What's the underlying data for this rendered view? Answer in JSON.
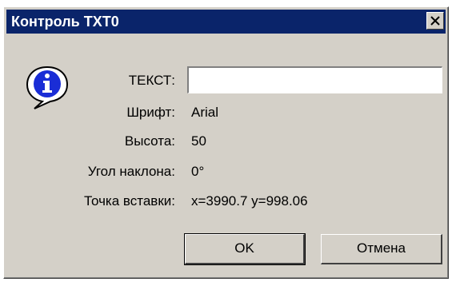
{
  "window": {
    "title": "Контроль TXT0",
    "close_icon": "close-icon"
  },
  "icon": "info-icon",
  "fields": {
    "text": {
      "label": "ТЕКСТ:",
      "value": ""
    },
    "font": {
      "label": "Шрифт:",
      "value": "Arial"
    },
    "height": {
      "label": "Высота:",
      "value": "50"
    },
    "angle": {
      "label": "Угол наклона:",
      "value": "0°"
    },
    "insertion_point": {
      "label": "Точка вставки:",
      "value": "x=3990.7 y=998.06"
    }
  },
  "buttons": {
    "ok": "OK",
    "cancel": "Отмена"
  },
  "colors": {
    "titlebar": "#0a246a",
    "dialog_face": "#d4d0c8"
  }
}
